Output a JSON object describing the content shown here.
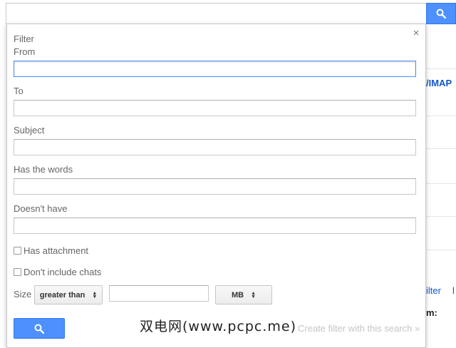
{
  "search_bar": {
    "value": "",
    "button_icon": "search-icon"
  },
  "background": {
    "imap_text": "/IMAP",
    "filter_link": "ilter",
    "cut_link": "l",
    "from_label": "m:"
  },
  "filter_popup": {
    "title": "Filter",
    "close_icon": "×",
    "fields": {
      "from": {
        "label": "From",
        "value": ""
      },
      "to": {
        "label": "To",
        "value": ""
      },
      "subject": {
        "label": "Subject",
        "value": ""
      },
      "has_words": {
        "label": "Has the words",
        "value": ""
      },
      "doesnt_have": {
        "label": "Doesn't have",
        "value": ""
      }
    },
    "checkboxes": {
      "has_attachment": {
        "label": "Has attachment",
        "checked": false
      },
      "dont_include_chats": {
        "label": "Don't include chats",
        "checked": false
      }
    },
    "size": {
      "label": "Size",
      "comparator": "greater than",
      "value": "",
      "unit": "MB"
    },
    "search_button_icon": "search-icon",
    "create_filter_link": "Create filter with this search »"
  },
  "watermark": "双电网(www.pcpc.me)",
  "colors": {
    "accent": "#4d90fe",
    "link": "#1155cc",
    "disabled_link": "#c5c5c5"
  }
}
